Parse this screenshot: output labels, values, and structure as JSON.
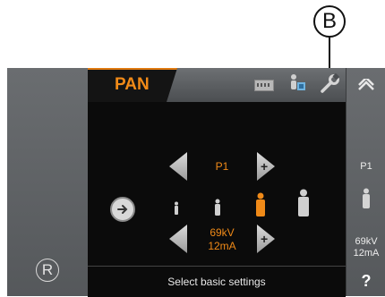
{
  "callout": {
    "label": "B"
  },
  "left_panel": {
    "r_label": "R"
  },
  "top_bar": {
    "tab_label": "PAN",
    "icons": [
      "keyboard-icon",
      "patient-setup-icon",
      "wrench-icon"
    ]
  },
  "program": {
    "value": "P1"
  },
  "exposure": {
    "kv": "69kV",
    "ma": "12mA"
  },
  "patient_sizes": [
    "small",
    "medium",
    "large-selected",
    "extra-large"
  ],
  "status": {
    "message": "Select basic settings"
  },
  "right_panel": {
    "program": "P1",
    "kv": "69kV",
    "ma": "12mA",
    "help_label": "?"
  },
  "colors": {
    "accent": "#f08a18",
    "screen_bg": "#0b0b0b",
    "frame": "#5a5d60"
  }
}
